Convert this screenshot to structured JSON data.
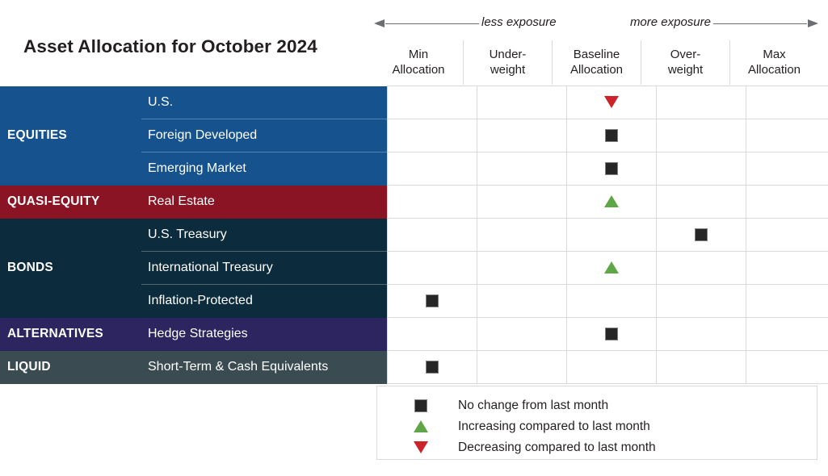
{
  "title": "Asset Allocation for October 2024",
  "exposure": {
    "less_label": "less exposure",
    "more_label": "more exposure",
    "left_arrow_icon": "arrow-left-icon",
    "right_arrow_icon": "arrow-right-icon"
  },
  "columns": [
    "Min\nAllocation",
    "Under-\nweight",
    "Baseline\nAllocation",
    "Over-\nweight",
    "Max\nAllocation"
  ],
  "columns_flat": [
    {
      "line1": "Min",
      "line2": "Allocation"
    },
    {
      "line1": "Under-",
      "line2": "weight"
    },
    {
      "line1": "Baseline",
      "line2": "Allocation"
    },
    {
      "line1": "Over-",
      "line2": "weight"
    },
    {
      "line1": "Max",
      "line2": "Allocation"
    }
  ],
  "categories": [
    {
      "name": "EQUITIES",
      "color": "#16538e",
      "rows": 3
    },
    {
      "name": "QUASI-EQUITY",
      "color": "#8a1424",
      "rows": 1
    },
    {
      "name": "BONDS",
      "color": "#0c2c3d",
      "rows": 3
    },
    {
      "name": "ALTERNATIVES",
      "color": "#2c2560",
      "rows": 1
    },
    {
      "name": "LIQUID",
      "color": "#3b4b52",
      "rows": 1
    }
  ],
  "rows": [
    {
      "category": "EQUITIES",
      "asset": "U.S.",
      "column": 2,
      "marker": "down"
    },
    {
      "category": "EQUITIES",
      "asset": "Foreign Developed",
      "column": 2,
      "marker": "square"
    },
    {
      "category": "EQUITIES",
      "asset": "Emerging Market",
      "column": 2,
      "marker": "square"
    },
    {
      "category": "QUASI-EQUITY",
      "asset": "Real Estate",
      "column": 2,
      "marker": "up"
    },
    {
      "category": "BONDS",
      "asset": "U.S. Treasury",
      "column": 3,
      "marker": "square"
    },
    {
      "category": "BONDS",
      "asset": "International Treasury",
      "column": 2,
      "marker": "up"
    },
    {
      "category": "BONDS",
      "asset": "Inflation-Protected",
      "column": 0,
      "marker": "square"
    },
    {
      "category": "ALTERNATIVES",
      "asset": "Hedge Strategies",
      "column": 2,
      "marker": "square"
    },
    {
      "category": "LIQUID",
      "asset": "Short-Term & Cash Equivalents",
      "column": 0,
      "marker": "square"
    }
  ],
  "legend": [
    {
      "marker": "square",
      "icon": "black-square-icon",
      "label": "No change from last month"
    },
    {
      "marker": "up",
      "icon": "green-up-triangle-icon",
      "label": "Increasing compared to last month"
    },
    {
      "marker": "down",
      "icon": "red-down-triangle-icon",
      "label": "Decreasing compared to last month"
    }
  ],
  "colors": {
    "equities": "#16538e",
    "quasi_equity": "#8a1424",
    "bonds": "#0c2c3d",
    "alternatives": "#2c2560",
    "liquid": "#3b4b52",
    "marker_square": "#262626",
    "marker_up": "#5fa646",
    "marker_down": "#cc2229",
    "grid": "#d9d9d9"
  },
  "chart_data": {
    "type": "table",
    "title": "Asset Allocation for October 2024",
    "categories": [
      "Min Allocation",
      "Under-weight",
      "Baseline Allocation",
      "Over-weight",
      "Max Allocation"
    ],
    "xlabel": "",
    "ylabel": "",
    "annotations": [
      "less exposure",
      "more exposure"
    ],
    "series": [
      {
        "name": "U.S.",
        "group": "EQUITIES",
        "position": "Baseline Allocation",
        "position_index": 2,
        "marker": "down",
        "meaning": "Decreasing compared to last month"
      },
      {
        "name": "Foreign Developed",
        "group": "EQUITIES",
        "position": "Baseline Allocation",
        "position_index": 2,
        "marker": "square",
        "meaning": "No change from last month"
      },
      {
        "name": "Emerging Market",
        "group": "EQUITIES",
        "position": "Baseline Allocation",
        "position_index": 2,
        "marker": "square",
        "meaning": "No change from last month"
      },
      {
        "name": "Real Estate",
        "group": "QUASI-EQUITY",
        "position": "Baseline Allocation",
        "position_index": 2,
        "marker": "up",
        "meaning": "Increasing compared to last month"
      },
      {
        "name": "U.S. Treasury",
        "group": "BONDS",
        "position": "Over-weight",
        "position_index": 3,
        "marker": "square",
        "meaning": "No change from last month"
      },
      {
        "name": "International Treasury",
        "group": "BONDS",
        "position": "Baseline Allocation",
        "position_index": 2,
        "marker": "up",
        "meaning": "Increasing compared to last month"
      },
      {
        "name": "Inflation-Protected",
        "group": "BONDS",
        "position": "Min Allocation",
        "position_index": 0,
        "marker": "square",
        "meaning": "No change from last month"
      },
      {
        "name": "Hedge Strategies",
        "group": "ALTERNATIVES",
        "position": "Baseline Allocation",
        "position_index": 2,
        "marker": "square",
        "meaning": "No change from last month"
      },
      {
        "name": "Short-Term & Cash Equivalents",
        "group": "LIQUID",
        "position": "Min Allocation",
        "position_index": 0,
        "marker": "square",
        "meaning": "No change from last month"
      }
    ],
    "legend_position": "bottom-right",
    "grid": true
  }
}
